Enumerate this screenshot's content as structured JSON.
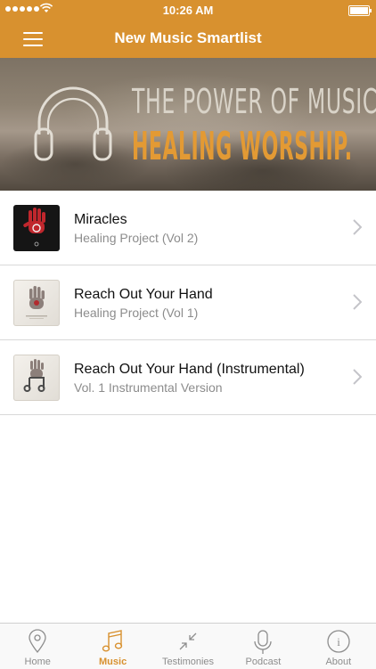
{
  "status": {
    "time": "10:26 AM"
  },
  "nav": {
    "title": "New Music Smartlist"
  },
  "banner": {
    "line1": "THE POWER OF MUSIC...",
    "line2": "HEALING WORSHIP."
  },
  "songs": [
    {
      "title": "Miracles",
      "subtitle": "Healing Project (Vol 2)",
      "cover": "red-hand-dark-cover"
    },
    {
      "title": "Reach Out Your Hand",
      "subtitle": "Healing Project (Vol 1)",
      "cover": "hand-light-cover"
    },
    {
      "title": "Reach Out Your Hand (Instrumental)",
      "subtitle": "Vol. 1 Instrumental Version",
      "cover": "hand-music-note-light-cover"
    }
  ],
  "tabs": [
    {
      "label": "Home",
      "icon": "map-pin-icon",
      "active": false
    },
    {
      "label": "Music",
      "icon": "music-note-icon",
      "active": true
    },
    {
      "label": "Testimonies",
      "icon": "collapse-arrows-icon",
      "active": false
    },
    {
      "label": "Podcast",
      "icon": "microphone-icon",
      "active": false
    },
    {
      "label": "About",
      "icon": "info-icon",
      "active": false
    }
  ],
  "colors": {
    "accent": "#d8912f",
    "tab_inactive": "#8d8d8d",
    "banner_orange": "#e39a34"
  }
}
